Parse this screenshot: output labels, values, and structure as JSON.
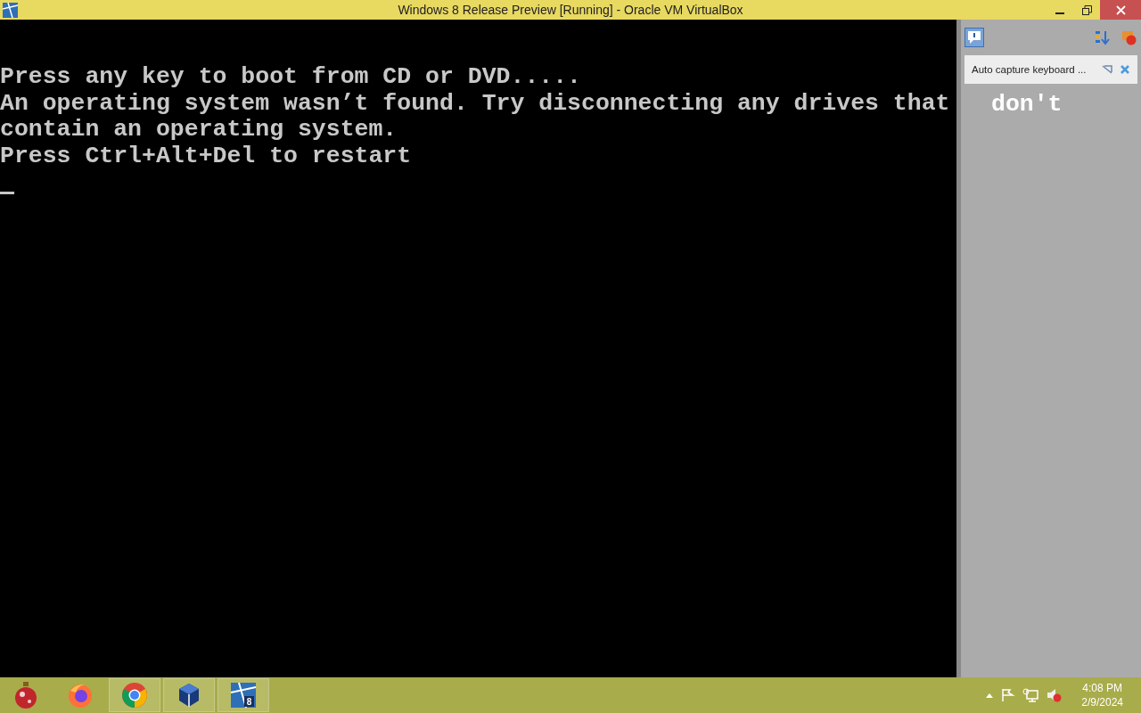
{
  "window": {
    "title": "Windows 8 Release Preview [Running] - Oracle VM VirtualBox"
  },
  "console": {
    "lines": [
      "Press any key to boot from CD or DVD.....",
      "An operating system wasn’t found. Try disconnecting any drives that",
      "contain an operating system.",
      "Press Ctrl+Alt+Del to restart"
    ],
    "hidden_overflow": "don't"
  },
  "notification_panel": {
    "messages": [
      {
        "text": "Auto capture keyboard ..."
      }
    ]
  },
  "taskbar": {
    "apps": [
      {
        "kind": "ornament",
        "selected": false
      },
      {
        "kind": "firefox",
        "selected": false
      },
      {
        "kind": "chrome",
        "selected": true
      },
      {
        "kind": "virtualbox",
        "selected": true
      },
      {
        "kind": "vm",
        "selected": true,
        "badge": "8"
      }
    ],
    "time": "4:08 PM",
    "date": "2/9/2024"
  }
}
